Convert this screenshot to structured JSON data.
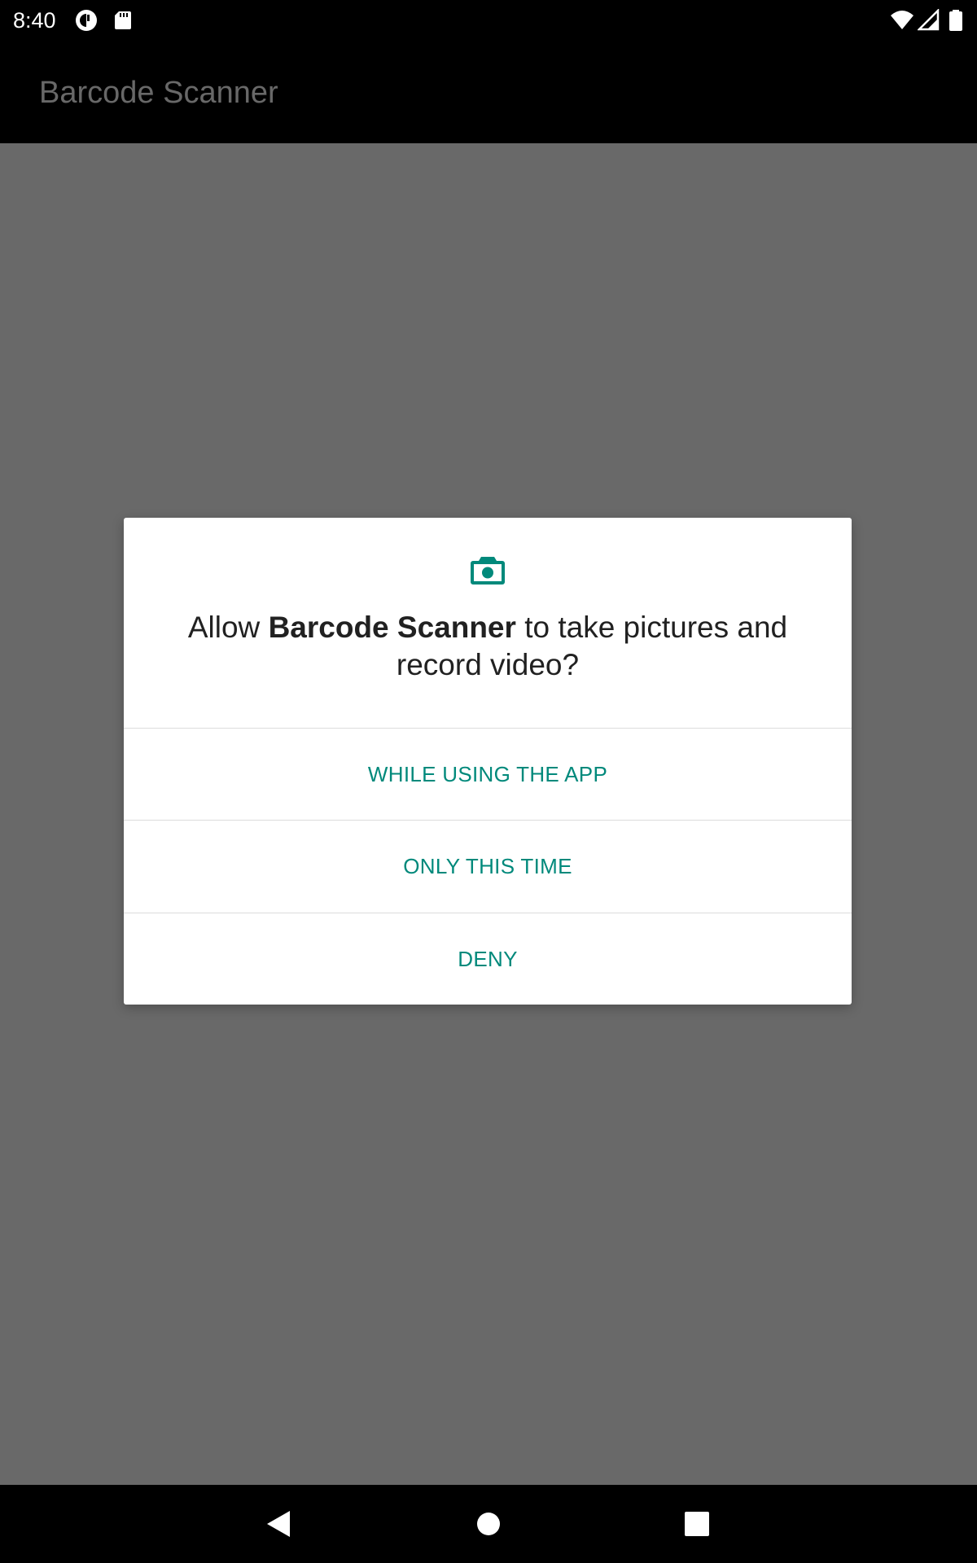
{
  "status_bar": {
    "time": "8:40",
    "icons": [
      "notification-app-icon",
      "sd-card-icon",
      "wifi-icon",
      "cell-signal-icon",
      "battery-icon"
    ]
  },
  "app_bar": {
    "title": "Barcode Scanner"
  },
  "dialog": {
    "icon": "camera-icon",
    "message_prefix": "Allow ",
    "app_name": "Barcode Scanner",
    "message_suffix": " to take pictures and record video?",
    "options": [
      {
        "label": "WHILE USING THE APP"
      },
      {
        "label": "ONLY THIS TIME"
      },
      {
        "label": "DENY"
      }
    ],
    "accent_color": "#00897b"
  },
  "nav_bar": {
    "buttons": [
      "back-icon",
      "home-icon",
      "recents-icon"
    ]
  }
}
